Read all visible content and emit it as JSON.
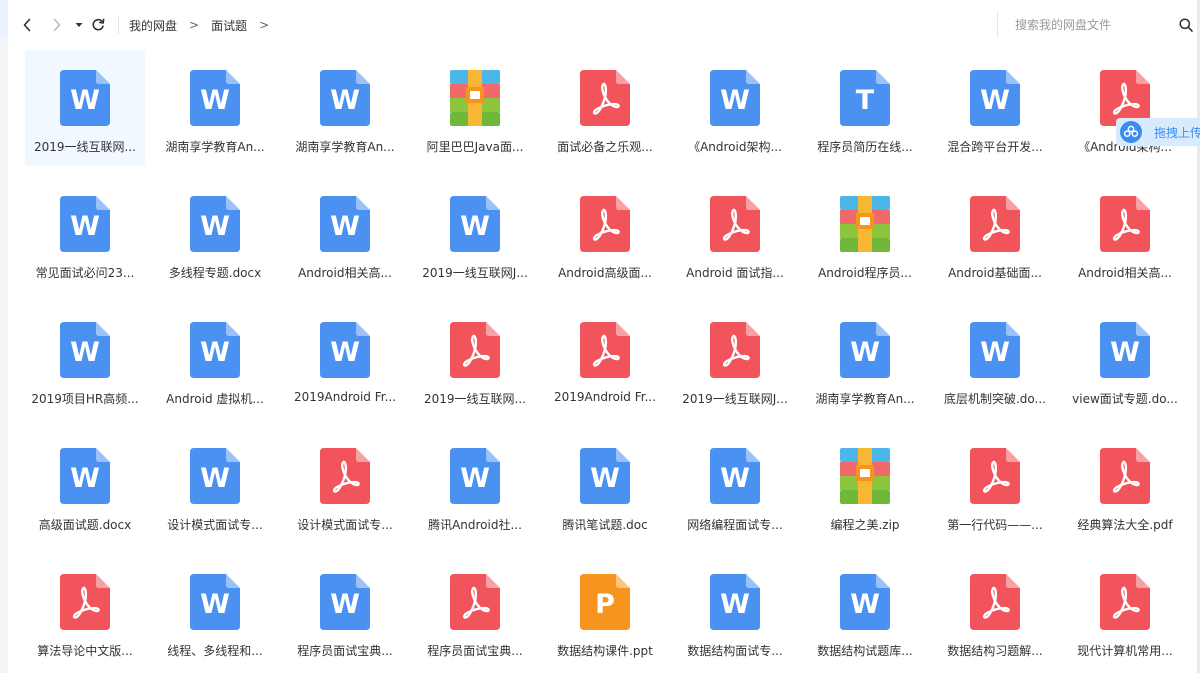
{
  "toolbar": {
    "back_icon": "chevron-left-icon",
    "forward_icon": "chevron-right-icon",
    "history_icon": "caret-down-icon",
    "refresh_icon": "refresh-icon",
    "breadcrumb": [
      "我的网盘",
      "面试题"
    ],
    "breadcrumb_separator": ">",
    "search_placeholder": "搜索我的网盘文件",
    "search_icon": "search-icon"
  },
  "drag_upload": {
    "label": "拖拽上传",
    "icon": "cloud-upload-icon"
  },
  "colors": {
    "word": "#4a91f2",
    "pdf": "#f2545b",
    "ppt": "#f7941d",
    "text": "#3b8cf0"
  },
  "files": [
    {
      "name": "2019一线互联网...",
      "type": "word",
      "selected": true
    },
    {
      "name": "湖南享学教育An...",
      "type": "word"
    },
    {
      "name": "湖南享学教育An...",
      "type": "word"
    },
    {
      "name": "阿里巴巴Java面...",
      "type": "zip"
    },
    {
      "name": "面试必备之乐观...",
      "type": "pdf"
    },
    {
      "name": "《Android架构...",
      "type": "word"
    },
    {
      "name": "程序员简历在线...",
      "type": "text"
    },
    {
      "name": "混合跨平台开发...",
      "type": "word"
    },
    {
      "name": "《Android架构...",
      "type": "pdf"
    },
    {
      "name": "常见面试必问23...",
      "type": "word"
    },
    {
      "name": "多线程专题.docx",
      "type": "word"
    },
    {
      "name": "Android相关高...",
      "type": "word"
    },
    {
      "name": "2019一线互联网J...",
      "type": "word"
    },
    {
      "name": "Android高级面...",
      "type": "pdf"
    },
    {
      "name": "Android 面试指...",
      "type": "pdf"
    },
    {
      "name": "Android程序员...",
      "type": "zip"
    },
    {
      "name": "Android基础面...",
      "type": "pdf"
    },
    {
      "name": "Android相关高...",
      "type": "pdf"
    },
    {
      "name": "2019项目HR高频...",
      "type": "word"
    },
    {
      "name": "Android 虚拟机...",
      "type": "word"
    },
    {
      "name": "2019Android Fr...",
      "type": "word"
    },
    {
      "name": "2019一线互联网...",
      "type": "pdf"
    },
    {
      "name": "2019Android Fr...",
      "type": "pdf"
    },
    {
      "name": "2019一线互联网J...",
      "type": "pdf"
    },
    {
      "name": "湖南享学教育An...",
      "type": "word"
    },
    {
      "name": "底层机制突破.do...",
      "type": "word"
    },
    {
      "name": "view面试专题.do...",
      "type": "word"
    },
    {
      "name": "高级面试题.docx",
      "type": "word"
    },
    {
      "name": "设计模式面试专...",
      "type": "word"
    },
    {
      "name": "设计模式面试专...",
      "type": "pdf"
    },
    {
      "name": "腾讯Android社...",
      "type": "word"
    },
    {
      "name": "腾讯笔试题.doc",
      "type": "word"
    },
    {
      "name": "网络编程面试专...",
      "type": "word"
    },
    {
      "name": "编程之美.zip",
      "type": "zip"
    },
    {
      "name": "第一行代码——...",
      "type": "pdf"
    },
    {
      "name": "经典算法大全.pdf",
      "type": "pdf"
    },
    {
      "name": "算法导论中文版...",
      "type": "pdf"
    },
    {
      "name": "线程、多线程和...",
      "type": "word"
    },
    {
      "name": "程序员面试宝典...",
      "type": "word"
    },
    {
      "name": "程序员面试宝典...",
      "type": "pdf"
    },
    {
      "name": "数据结构课件.ppt",
      "type": "ppt"
    },
    {
      "name": "数据结构面试专...",
      "type": "word"
    },
    {
      "name": "数据结构试题库...",
      "type": "word"
    },
    {
      "name": "数据结构习题解...",
      "type": "pdf"
    },
    {
      "name": "现代计算机常用...",
      "type": "pdf"
    }
  ]
}
